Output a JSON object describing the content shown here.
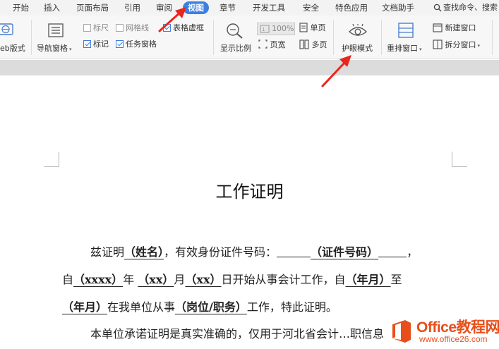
{
  "menu": {
    "tabs": [
      "开始",
      "插入",
      "页面布局",
      "引用",
      "审阅",
      "视图",
      "章节",
      "开发工具",
      "安全",
      "特色应用",
      "文档助手"
    ],
    "active_tab": "视图",
    "search_placeholder": "查找命令、搜索"
  },
  "ribbon": {
    "web_layout_label": "eb版式",
    "nav_pane_label": "导航窗格",
    "ruler_label": "标尺",
    "gridlines_label": "网格线",
    "table_gridlines_label": "表格虚框",
    "marker_label": "标记",
    "task_pane_label": "任务窗格",
    "zoom_label": "显示比例",
    "zoom_value": "100%",
    "single_page_label": "单页",
    "page_width_label": "页宽",
    "multi_page_label": "多页",
    "eye_mode_label": "护眼模式",
    "arrange_label": "重排窗口",
    "new_window_label": "新建窗口",
    "split_window_label": "拆分窗口",
    "ruler_checked": false,
    "gridlines_checked": false,
    "table_gridlines_checked": true,
    "marker_checked": true,
    "task_pane_checked": true
  },
  "document": {
    "title": "工作证明",
    "line1": {
      "a": "兹证明",
      "name": "（姓名）",
      "b": "，有效身份证件号码：",
      "id": "（证件号码）",
      "c": "，"
    },
    "line2": {
      "a": "自",
      "year": "（xxxx）",
      "b": "年",
      "month": "（xx）",
      "c": "月",
      "day": "（xx）",
      "d": "日开始从事会计工作，自",
      "ym1": "（年月）",
      "e": "至"
    },
    "line3": {
      "ym2": "（年月）",
      "a": "在我单位从事",
      "post": "（岗位/职务）",
      "b": "工作，特此证明。"
    },
    "line4": "本单位承诺证明是真实准确的，仅用于河北省会计…职信息"
  },
  "watermark": {
    "brand": "Office教程网",
    "url": "www.office26.com"
  },
  "colors": {
    "accent": "#3d7fe0",
    "arrow": "#e8261c",
    "watermark": "#e84e1b"
  }
}
